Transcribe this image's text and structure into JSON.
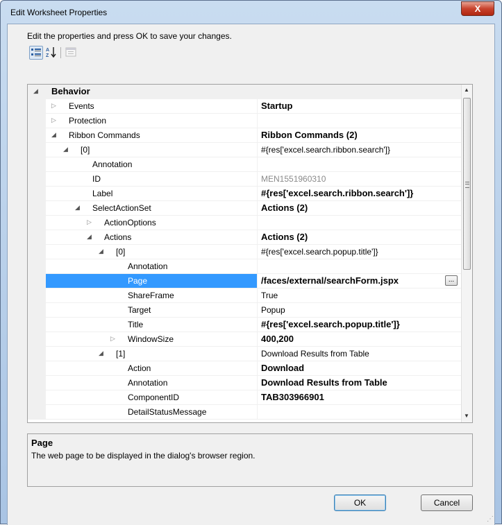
{
  "window": {
    "title": "Edit Worksheet Properties",
    "close_glyph": "X"
  },
  "instructions": "Edit the properties and press OK to save your changes.",
  "toolbar": {
    "categorized_icon": "categorized-icon",
    "alphabetical_icon": "sort-az-icon",
    "pages_icon": "property-pages-icon"
  },
  "grid": {
    "rows": [
      {
        "name": "Behavior",
        "value": "",
        "indent": 0,
        "glyph": "collapse",
        "category": true
      },
      {
        "name": "Events",
        "value": "Startup",
        "indent": 0,
        "glyph": "expand",
        "value_bold": true
      },
      {
        "name": "Protection",
        "value": "",
        "indent": 0,
        "glyph": "expand"
      },
      {
        "name": "Ribbon Commands",
        "value": "Ribbon Commands (2)",
        "indent": 0,
        "glyph": "collapse",
        "value_bold": true
      },
      {
        "name": "[0]",
        "value": "#{res['excel.search.ribbon.search']}",
        "indent": 1,
        "glyph": "collapse"
      },
      {
        "name": "Annotation",
        "value": "",
        "indent": 2,
        "glyph": "none"
      },
      {
        "name": "ID",
        "value": "MEN1551960310",
        "indent": 2,
        "glyph": "none",
        "gray": true
      },
      {
        "name": "Label",
        "value": "#{res['excel.search.ribbon.search']}",
        "indent": 2,
        "glyph": "none",
        "value_bold": true
      },
      {
        "name": "SelectActionSet",
        "value": "Actions (2)",
        "indent": 2,
        "glyph": "collapse",
        "value_bold": true
      },
      {
        "name": "ActionOptions",
        "value": "",
        "indent": 3,
        "glyph": "expand"
      },
      {
        "name": "Actions",
        "value": "Actions (2)",
        "indent": 3,
        "glyph": "collapse",
        "value_bold": true
      },
      {
        "name": "[0]",
        "value": "#{res['excel.search.popup.title']}",
        "indent": 4,
        "glyph": "collapse"
      },
      {
        "name": "Annotation",
        "value": "",
        "indent": 5,
        "glyph": "none"
      },
      {
        "name": "Page",
        "value": "/faces/external/searchForm.jspx",
        "indent": 5,
        "glyph": "none",
        "value_bold": true,
        "selected": true,
        "ellipsis": "..."
      },
      {
        "name": "ShareFrame",
        "value": "True",
        "indent": 5,
        "glyph": "none"
      },
      {
        "name": "Target",
        "value": "Popup",
        "indent": 5,
        "glyph": "none"
      },
      {
        "name": "Title",
        "value": "#{res['excel.search.popup.title']}",
        "indent": 5,
        "glyph": "none",
        "value_bold": true
      },
      {
        "name": "WindowSize",
        "value": "400,200",
        "indent": 5,
        "glyph": "expand",
        "value_bold": true
      },
      {
        "name": "[1]",
        "value": "Download Results from Table",
        "indent": 4,
        "glyph": "collapse"
      },
      {
        "name": "Action",
        "value": "Download",
        "indent": 5,
        "glyph": "none",
        "value_bold": true
      },
      {
        "name": "Annotation",
        "value": "Download Results from Table",
        "indent": 5,
        "glyph": "none",
        "value_bold": true
      },
      {
        "name": "ComponentID",
        "value": "TAB303966901",
        "indent": 5,
        "glyph": "none",
        "value_bold": true
      },
      {
        "name": "DetailStatusMessage",
        "value": "",
        "indent": 5,
        "glyph": "none"
      }
    ]
  },
  "help": {
    "title": "Page",
    "description": "The web page to be displayed in the dialog's browser region."
  },
  "buttons": {
    "ok": "OK",
    "cancel": "Cancel"
  },
  "colors": {
    "selection": "#3399ff",
    "close_button": "#c8432d"
  }
}
